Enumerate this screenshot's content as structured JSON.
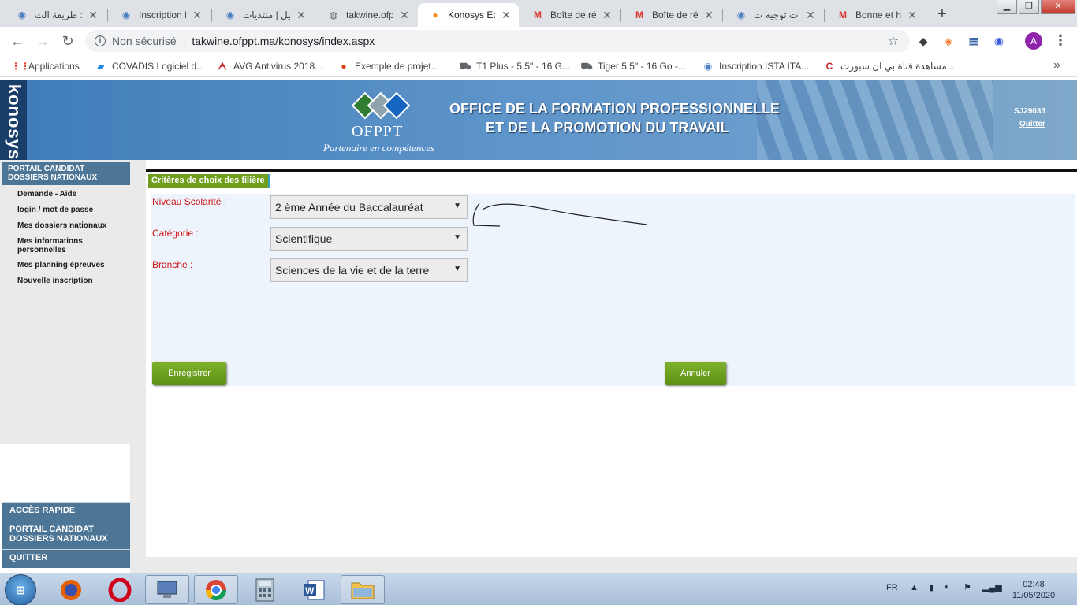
{
  "browser": {
    "tabs": [
      {
        "title": "جديد : طريقة الت",
        "icon": "globe-eye-icon",
        "active": false
      },
      {
        "title": "Inscription IS",
        "icon": "globe-eye-icon",
        "active": false
      },
      {
        "title": "تسجيل | منتديات",
        "icon": "globe-eye-icon",
        "active": false
      },
      {
        "title": "takwine.ofppt",
        "icon": "globe-icon",
        "active": false
      },
      {
        "title": "Konosys Edu",
        "icon": "konosys-dot-icon",
        "active": true
      },
      {
        "title": "Boîte de réc",
        "icon": "gmail-icon",
        "active": false
      },
      {
        "title": "Boîte de réc",
        "icon": "gmail-icon",
        "active": false
      },
      {
        "title": "منتديات توجيه ت",
        "icon": "globe-eye-icon",
        "active": false
      },
      {
        "title": "Bonne et he",
        "icon": "gmail-icon",
        "active": false
      }
    ],
    "new_tab": "+",
    "security_label": "Non sécurisé",
    "url": "takwine.ofppt.ma/konosys/index.aspx",
    "profile_initial": "A",
    "bookmarks": [
      {
        "label": "Applications",
        "icon": "apps-grid-icon"
      },
      {
        "label": "COVADIS Logiciel d...",
        "icon": "covadis-icon"
      },
      {
        "label": "AVG Antivirus 2018...",
        "icon": "avg-icon"
      },
      {
        "label": "Exemple de projet...",
        "icon": "owl-icon"
      },
      {
        "label": "T1 Plus - 5.5\" - 16 G...",
        "icon": "cart-icon"
      },
      {
        "label": "Tiger 5.5\" - 16 Go -...",
        "icon": "cart-icon"
      },
      {
        "label": "Inscription ISTA ITA...",
        "icon": "globe-eye-icon"
      },
      {
        "label": "مشاهدة قناة بي ان سبورت...",
        "icon": "c-logo-icon"
      }
    ],
    "bookmarks_more": "»"
  },
  "header": {
    "brand": "konosys",
    "logo_name": "OFPPT",
    "tagline": "Partenaire en compétences",
    "title_line1": "OFFICE DE LA FORMATION PROFESSIONNELLE",
    "title_line2": "ET DE LA PROMOTION DU TRAVAIL",
    "user_code": "SJ29033",
    "quit_label": "Quitter"
  },
  "sidebar": {
    "heading": "PORTAIL CANDIDAT DOSSIERS NATIONAUX",
    "links": [
      "Demande - Aide",
      "login / mot de passe",
      "Mes dossiers nationaux",
      "Mes informations personnelles",
      "Mes planning épreuves",
      "Nouvelle inscription"
    ],
    "quick_menu": [
      "ACCÈS RAPIDE",
      "PORTAIL CANDIDAT DOSSIERS NATIONAUX",
      "QUITTER"
    ]
  },
  "form": {
    "section_title": "Critères de choix des filière",
    "fields": [
      {
        "label": "Niveau Scolarité :",
        "value": "2 ème Année du Baccalauréat"
      },
      {
        "label": "Catégorie :",
        "value": "Scientifique"
      },
      {
        "label": "Branche :",
        "value": "Sciences de la vie et de la terre"
      }
    ],
    "save_label": "Enregistrer",
    "cancel_label": "Annuler"
  },
  "taskbar": {
    "apps": [
      "firefox-icon",
      "opera-icon",
      "network-computer-icon",
      "chrome-icon",
      "calculator-icon",
      "word-icon",
      "file-explorer-icon"
    ],
    "language": "FR",
    "time": "02:48",
    "date": "11/05/2020"
  },
  "colors": {
    "sidebar_header": "#4d7696",
    "green_button": "#6e9e1c",
    "label_red": "#cc1111",
    "form_bg": "#eef4fb"
  }
}
